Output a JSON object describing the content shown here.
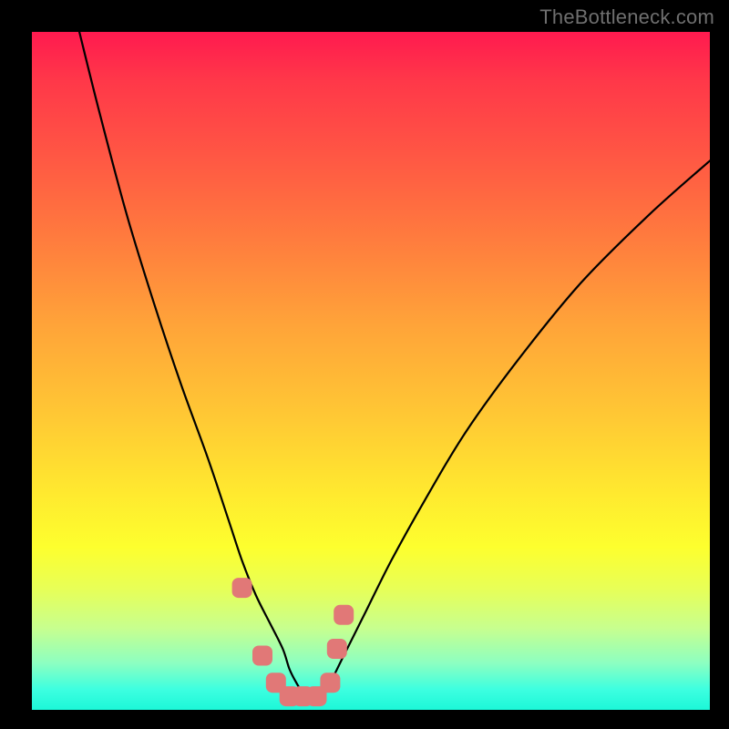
{
  "watermark": "TheBottleneck.com",
  "chart_data": {
    "type": "line",
    "title": "",
    "xlabel": "",
    "ylabel": "",
    "xlim": [
      0,
      100
    ],
    "ylim": [
      0,
      100
    ],
    "series": [
      {
        "name": "bottleneck-curve",
        "x": [
          7,
          10,
          14,
          18,
          22,
          26,
          29,
          31,
          33,
          35,
          37,
          38,
          39,
          40,
          41,
          42,
          43,
          44,
          46,
          49,
          53,
          58,
          64,
          72,
          81,
          91,
          100
        ],
        "y": [
          100,
          88,
          73,
          60,
          48,
          37,
          28,
          22,
          17,
          13,
          9,
          6,
          4,
          2.5,
          2,
          2,
          2.5,
          4,
          8,
          14,
          22,
          31,
          41,
          52,
          63,
          73,
          81
        ]
      }
    ],
    "markers": {
      "name": "highlight-points",
      "x": [
        31,
        34,
        36,
        38,
        40,
        42,
        44,
        45,
        46
      ],
      "y": [
        18,
        8,
        4,
        2,
        2,
        2,
        4,
        9,
        14
      ]
    },
    "gradient_stops": [
      {
        "pos": 0,
        "color": "#ff1a4f"
      },
      {
        "pos": 25,
        "color": "#ff7a3e"
      },
      {
        "pos": 55,
        "color": "#ffe92f"
      },
      {
        "pos": 85,
        "color": "#c7ff8f"
      },
      {
        "pos": 100,
        "color": "#1cf7d8"
      }
    ]
  }
}
